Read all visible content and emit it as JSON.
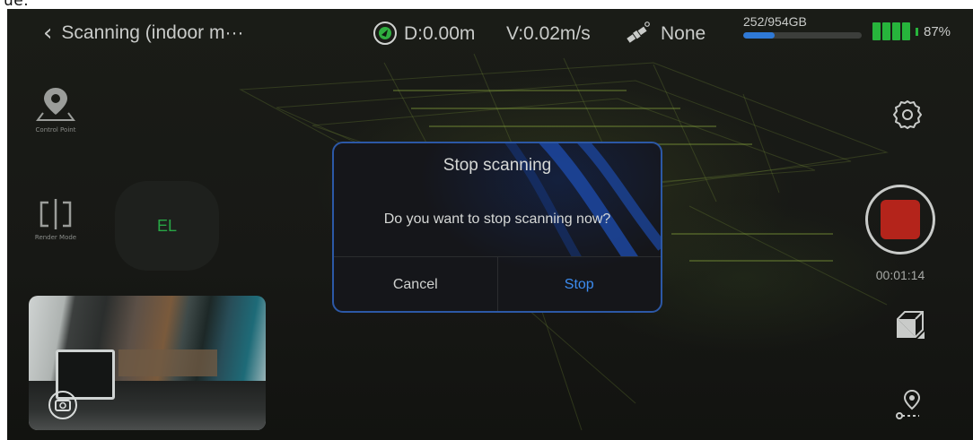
{
  "above_text": "ue.",
  "topbar": {
    "back_label": "Scanning (indoor m···",
    "distance": "D:0.00m",
    "velocity": "V:0.02m/s",
    "rtk_status": "None",
    "storage": "252/954GB",
    "storage_used_fraction": 0.264,
    "battery": "87%",
    "battery_level_fraction": 0.87
  },
  "left": {
    "control_point_label": "Control Point",
    "render_mode_label": "Render Mode",
    "el_label": "EL"
  },
  "dialog": {
    "title": "Stop scanning",
    "message": "Do you want to stop scanning now?",
    "cancel_label": "Cancel",
    "stop_label": "Stop"
  },
  "right": {
    "timer": "00:01:14"
  },
  "icons": {
    "back": "chevron-left-icon",
    "gnss": "gnss-icon",
    "satellite": "satellite-icon",
    "control_point": "map-pin-icon",
    "render_mode": "split-view-icon",
    "camera_switch": "camera-switch-icon",
    "settings": "gear-icon",
    "cube": "cube-icon",
    "route": "route-pin-icon"
  },
  "colors": {
    "accent_blue": "#3c8cf0",
    "record_red": "#b4241b",
    "battery_green": "#27b43c",
    "storage_blue": "#2f79d6",
    "el_green": "#28a745"
  }
}
